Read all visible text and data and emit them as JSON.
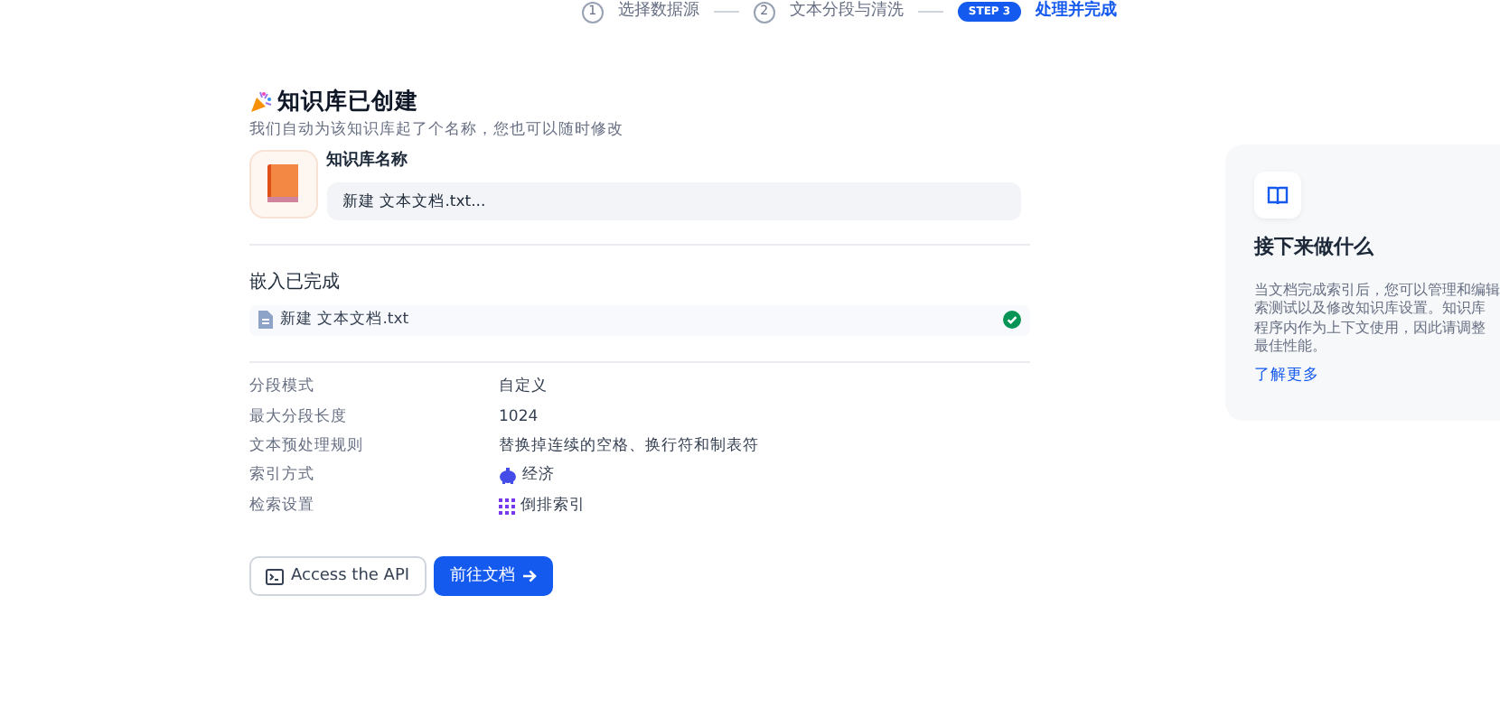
{
  "stepper": [
    {
      "kind": "number",
      "badge": "1",
      "label": "选择数据源",
      "selected": false
    },
    {
      "kind": "number",
      "badge": "2",
      "label": "文本分段与清洗",
      "selected": false
    },
    {
      "kind": "pill",
      "badge": "STEP 3",
      "label": "处理并完成",
      "selected": true
    }
  ],
  "created": {
    "title": "知识库已创建",
    "subtitle": "我们自动为该知识库起了个名称，您也可以随时修改",
    "name_label": "知识库名称",
    "name_value": "新建 文本文档.txt..."
  },
  "embedding": {
    "title": "嵌入已完成",
    "files": [
      {
        "name": "新建 文本文档.txt",
        "done": true
      }
    ]
  },
  "settings": [
    {
      "label": "分段模式",
      "value": "自定义",
      "kind": "text"
    },
    {
      "label": "最大分段长度",
      "value": "1024",
      "kind": "text"
    },
    {
      "label": "文本预处理规则",
      "value": "替换掉连续的空格、换行符和制表符",
      "kind": "text"
    },
    {
      "label": "索引方式",
      "value": "经济",
      "kind": "economy"
    },
    {
      "label": "检索设置",
      "value": "倒排索引",
      "kind": "grid"
    }
  ],
  "buttons": [
    {
      "label": "Access the API",
      "kind": "secondary"
    },
    {
      "label": "前往文档",
      "kind": "primary"
    }
  ],
  "next_panel": {
    "title": "接下来做什么",
    "description_lines": [
      "当文档完成索引后，您可以管理和编辑",
      "索测试以及修改知识库设置。知识库",
      "程序内作为上下文使用，因此请调整",
      "最佳性能。"
    ],
    "link": "了解更多"
  }
}
